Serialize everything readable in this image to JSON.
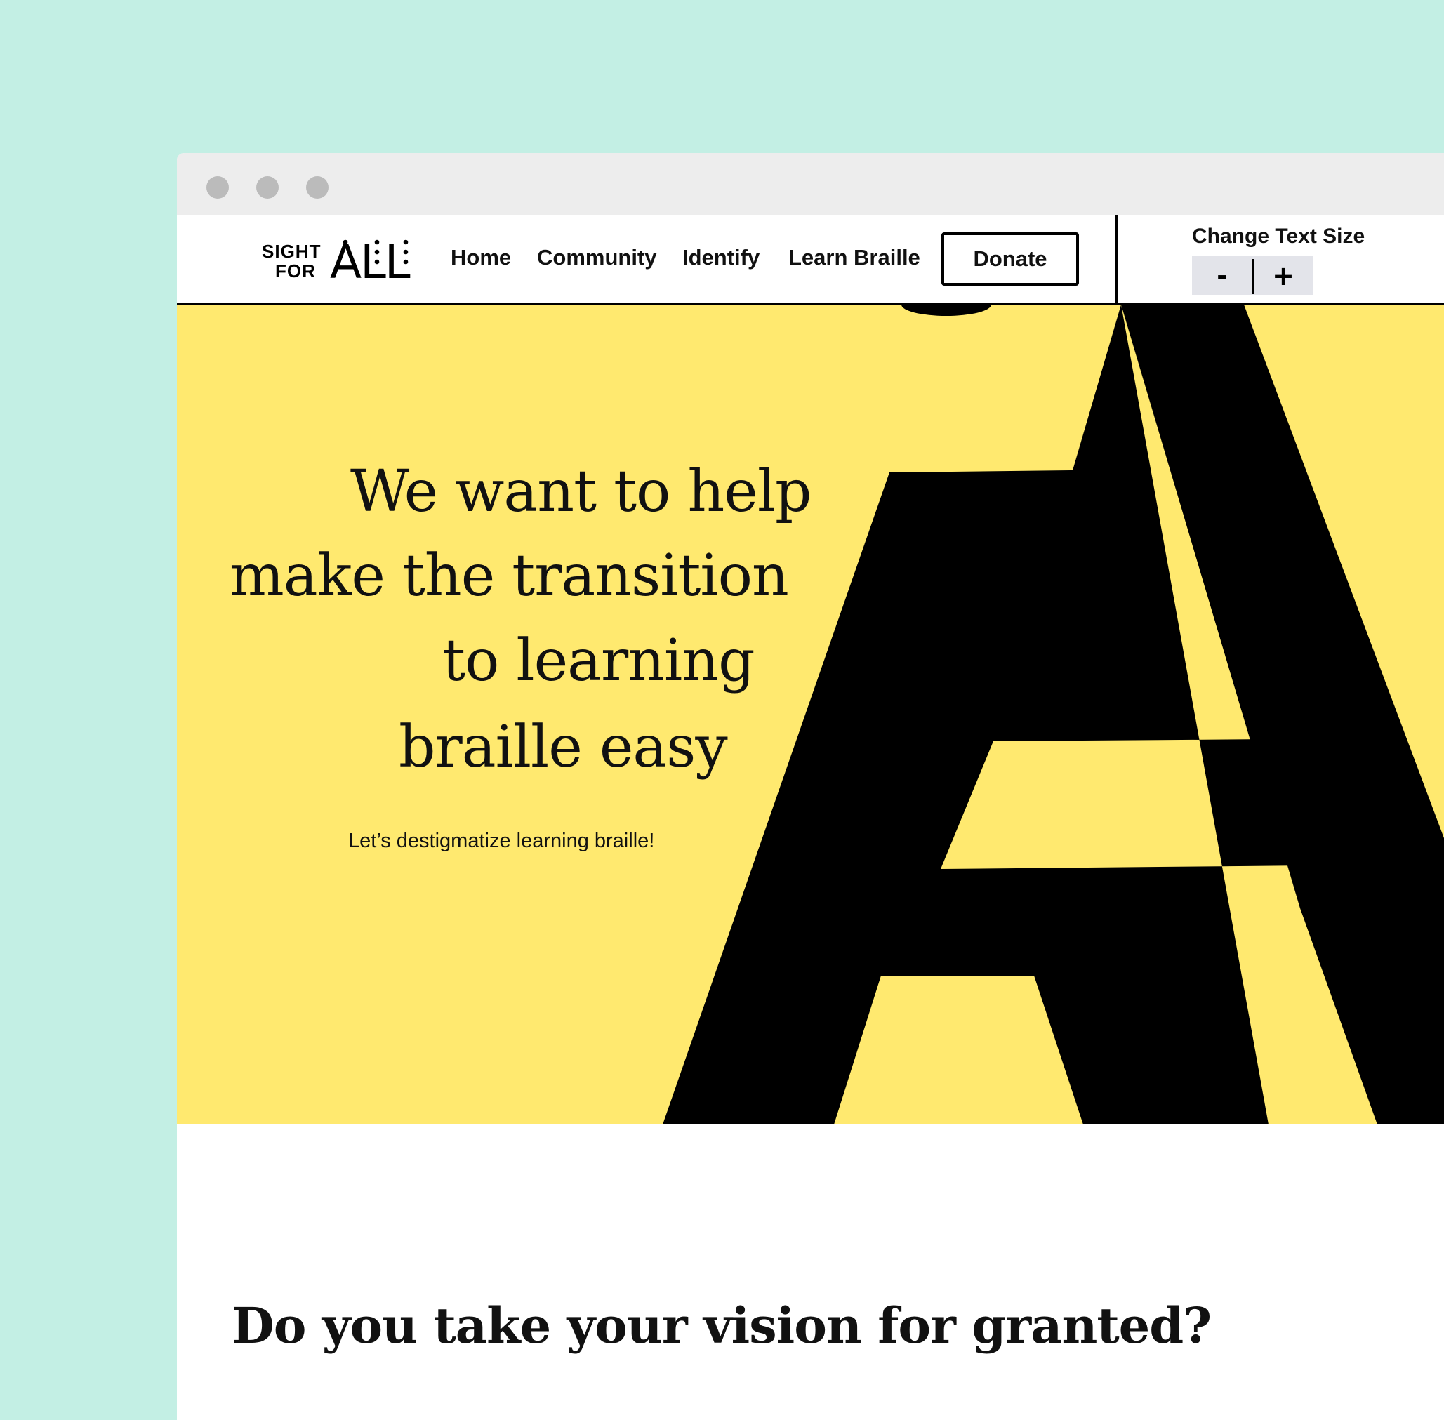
{
  "colors": {
    "page_background": "#c3efe4",
    "hero_background": "#ffe96f",
    "title_bar": "#ededed",
    "text": "#111111",
    "text_size_control": "#e3e4ea"
  },
  "logo": {
    "line1": "SIGHT",
    "line2": "FOR",
    "word": "ALL"
  },
  "nav": {
    "items": [
      {
        "label": "Home"
      },
      {
        "label": "Community"
      },
      {
        "label": "Identify"
      },
      {
        "label": "Learn Braille"
      }
    ],
    "donate_label": "Donate"
  },
  "text_size": {
    "label": "Change Text Size",
    "decrease": "-",
    "increase": "+"
  },
  "hero": {
    "headline_lines": [
      "We want to help",
      "make the transition",
      "to learning",
      "braille easy"
    ],
    "subtitle": "Let’s destigmatize learning braille!",
    "background_letter": "A"
  },
  "section": {
    "heading": "Do you take your vision for granted?"
  }
}
